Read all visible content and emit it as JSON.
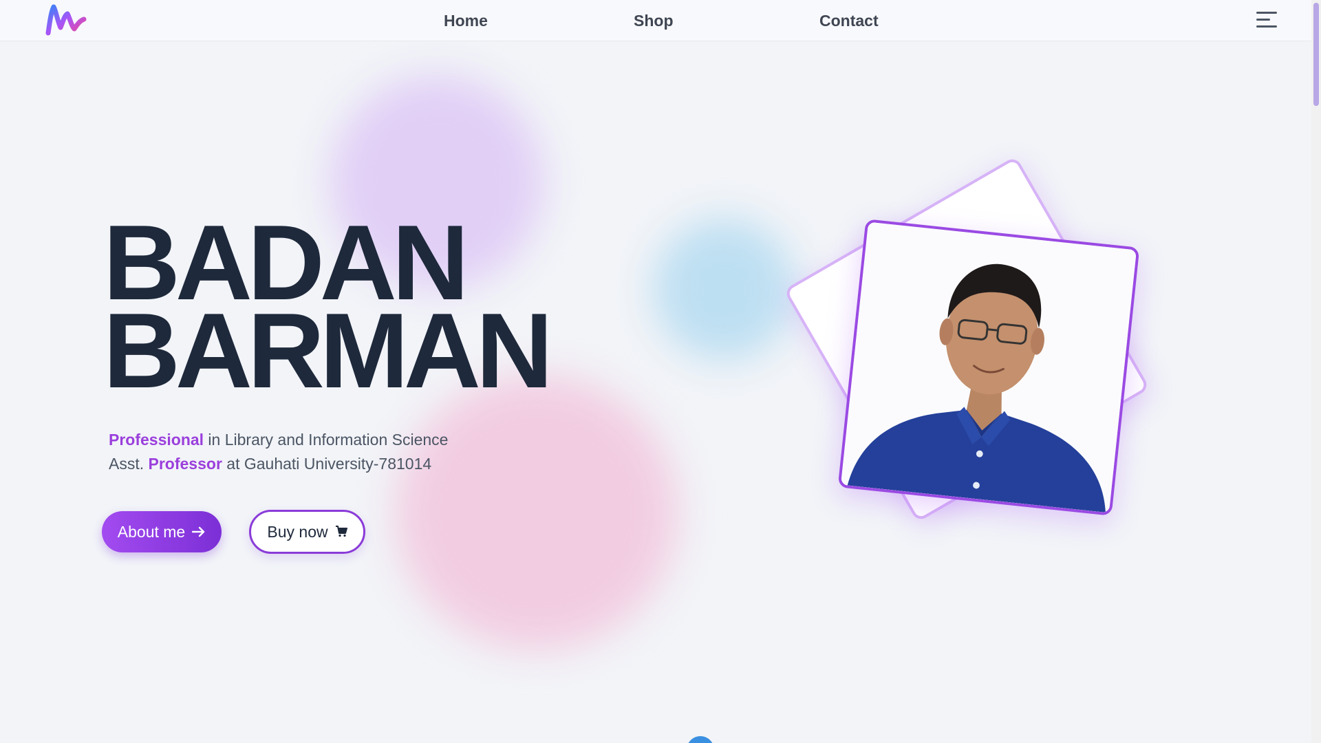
{
  "nav": {
    "links": [
      "Home",
      "Shop",
      "Contact"
    ],
    "logo": "brand-m-logo-icon",
    "menu_icon": "hamburger-menu-icon"
  },
  "hero": {
    "name_line1": "BADAN",
    "name_line2": "BARMAN",
    "line1_highlight": "Professional",
    "line1_rest": " in Library and Information Science",
    "line2_prefix": "Asst. ",
    "line2_highlight": "Professor",
    "line2_rest": " at Gauhati University-781014",
    "about_button": "About me",
    "about_icon": "arrow-right-icon",
    "buy_button": "Buy now",
    "buy_icon": "cart-icon",
    "portrait": "portrait-photo"
  },
  "colors": {
    "accent": "#9b3fdc",
    "heading": "#1e293b",
    "background": "#f2f4f8"
  }
}
